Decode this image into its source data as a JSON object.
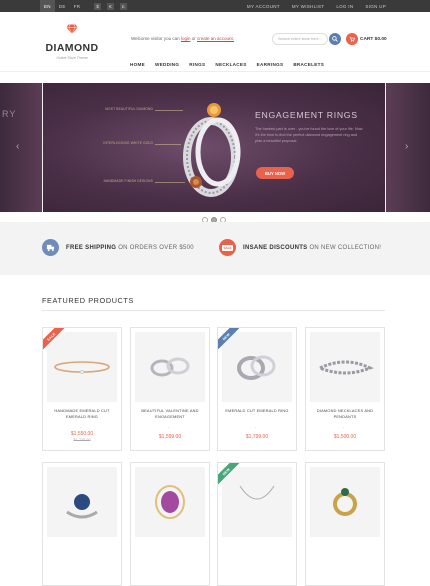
{
  "topbar": {
    "languages": [
      "EN",
      "DE",
      "FR"
    ],
    "currencies": [
      "$",
      "€",
      "£"
    ],
    "links": [
      "MY ACCOUNT",
      "MY WISHLIST",
      "LOG IN",
      "SIGN UP"
    ]
  },
  "header": {
    "logo_name": "DIAMOND",
    "logo_tagline": "Online Store Theme",
    "welcome_text": "Welcome visitor you can",
    "login_link": "login",
    "or_text": "or",
    "create_link": "create an account.",
    "search_placeholder": "Search entire store here...",
    "cart_label": "CART $0.00"
  },
  "nav": [
    "HOME",
    "WEDDING",
    "RINGS",
    "NECKLACES",
    "EARRINGS",
    "BRACELETS"
  ],
  "slider": {
    "left_peek_text": "RY",
    "left_peek_sub": "...you\nl go\ncious",
    "title": "ENGAGEMENT RINGS",
    "description": "The hardest part is over - you've found the love of your life. Now it's the time to find the perfect diamond engagement ring and plan a beautiful proposal.",
    "button": "BUY NOW",
    "ring_labels": [
      "MOST BEAUTIFUL DIAMOND",
      "INTERLOCKING WHITE GOLD",
      "HANDMADE FINISH DESIGNS"
    ],
    "dots": 3,
    "active_dot": 1
  },
  "promo": {
    "shipping_bold": "FREE SHIPPING",
    "shipping_rest": "ON ORDERS OVER $500",
    "discount_bold": "INSANE DISCOUNTS",
    "discount_rest": "ON NEW COLLECTION!",
    "discount_icon_text": "SALE"
  },
  "featured": {
    "title": "FEATURED PRODUCTS",
    "products": [
      {
        "name": "HANDMADE EMERALD CUT EMERALD RING",
        "price": "$1,550.00",
        "old_price": "$1,725.00",
        "ribbon": "SALE",
        "ribbon_color": "#e8624c"
      },
      {
        "name": "BEAUTIFUL VALENTINE AND ENGAGEMENT",
        "price": "$1,599.00",
        "old_price": "",
        "ribbon": "",
        "ribbon_color": ""
      },
      {
        "name": "EMERALD CUT EMERALD RING",
        "price": "$1,799.00",
        "old_price": "",
        "ribbon": "NEW",
        "ribbon_color": "#5b7fb0"
      },
      {
        "name": "DIAMOND NECKLACES AND PENDANTS",
        "price": "$1,500.00",
        "old_price": "",
        "ribbon": "",
        "ribbon_color": ""
      }
    ],
    "second_row_ribbon": "NEW",
    "second_row_ribbon_color": "#4aa67a"
  },
  "colors": {
    "accent": "#e8624c",
    "blue": "#5b7fb0",
    "green": "#4aa67a"
  }
}
